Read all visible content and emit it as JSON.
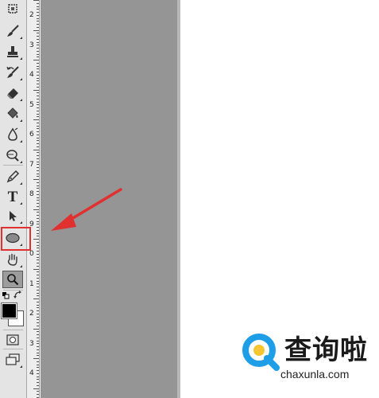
{
  "ruler": {
    "numbers": [
      "2",
      "3",
      "4",
      "5",
      "6",
      "7",
      "8",
      "9",
      "0",
      "1",
      "2",
      "3",
      "4"
    ]
  },
  "toolbar": {
    "tools": [
      {
        "name": "crop-tool",
        "icon": "crop-icon"
      },
      {
        "name": "brush-tool",
        "icon": "brush-icon"
      },
      {
        "name": "clone-stamp-tool",
        "icon": "stamp-icon"
      },
      {
        "name": "history-brush-tool",
        "icon": "history-brush-icon"
      },
      {
        "name": "eraser-tool",
        "icon": "eraser-icon"
      },
      {
        "name": "paint-bucket-tool",
        "icon": "bucket-icon"
      },
      {
        "name": "blur-tool",
        "icon": "blur-icon"
      },
      {
        "name": "dodge-tool",
        "icon": "dodge-icon"
      },
      {
        "name": "pen-tool",
        "icon": "pen-icon"
      },
      {
        "name": "type-tool",
        "icon": "type-icon",
        "label": "T"
      },
      {
        "name": "path-selection-tool",
        "icon": "arrow-icon"
      },
      {
        "name": "ellipse-tool",
        "icon": "ellipse-icon"
      },
      {
        "name": "hand-tool",
        "icon": "hand-icon"
      },
      {
        "name": "zoom-tool",
        "icon": "magnifier-icon"
      }
    ],
    "highlighted_tool": "ellipse-tool"
  },
  "colors": {
    "highlight": "#e03030",
    "arrow": "#e03030",
    "canvas_gray": "#959595",
    "watermark_blue": "#1e9ee6",
    "watermark_yellow": "#f7c531"
  },
  "watermark": {
    "cn": "查询啦",
    "en": "chaxunla.com"
  }
}
